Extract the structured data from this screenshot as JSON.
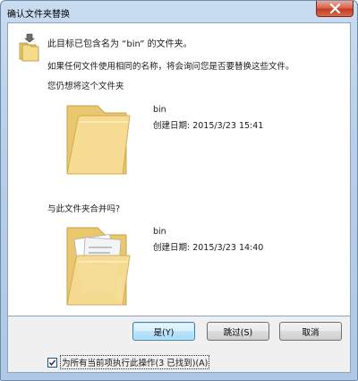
{
  "window": {
    "title": "确认文件夹替换"
  },
  "message": {
    "main": "此目标已包含名为 “bin” 的文件夹。",
    "detail": "如果任何文件使用相同的名称，将会询问您是否要替换这些文件。",
    "prompt_replace": "您仍想将这个文件夹",
    "prompt_merge": "与此文件夹合并吗?"
  },
  "source_folder": {
    "name": "bin",
    "created": "创建日期: 2015/3/23 15:41"
  },
  "target_folder": {
    "name": "bin",
    "created": "创建日期: 2015/3/23 14:40"
  },
  "buttons": {
    "yes": "是(Y)",
    "skip": "跳过(S)",
    "cancel": "取消"
  },
  "apply_all": {
    "label": "为所有当前项执行此操作(3 已找到)(A)",
    "checked": true
  },
  "colors": {
    "folder": "#f1d98c",
    "primary_border": "#3c7fb1",
    "close": "#c43b22"
  }
}
